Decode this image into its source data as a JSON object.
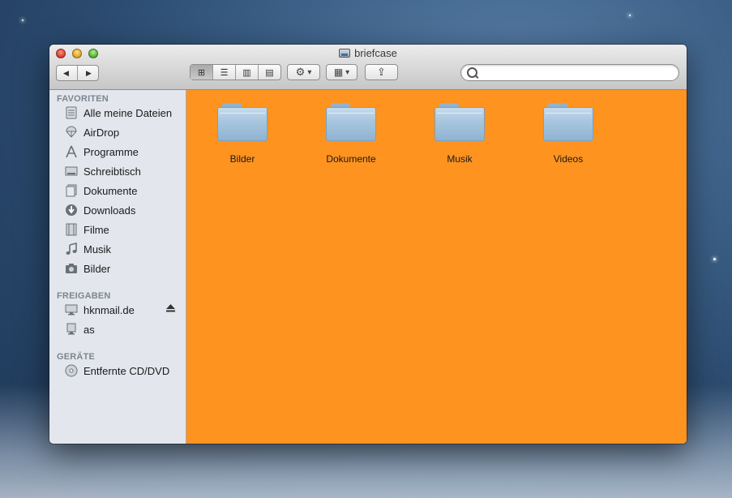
{
  "window": {
    "title": "briefcase"
  },
  "toolbar": {
    "back_icon": "◀",
    "forward_icon": "▶",
    "view_icons": [
      "⊞",
      "☰",
      "▥",
      "▤"
    ],
    "action_icon": "⚙",
    "arrange_icon": "▦",
    "share_icon": "⇪",
    "dropdown_icon": "▾"
  },
  "search": {
    "value": "",
    "placeholder": ""
  },
  "sidebar": {
    "favorites_header": "FAVORITEN",
    "favorites": [
      {
        "label": "Alle meine Dateien",
        "icon": "all-files-icon"
      },
      {
        "label": "AirDrop",
        "icon": "airdrop-icon"
      },
      {
        "label": "Programme",
        "icon": "applications-icon"
      },
      {
        "label": "Schreibtisch",
        "icon": "desktop-icon"
      },
      {
        "label": "Dokumente",
        "icon": "documents-icon"
      },
      {
        "label": "Downloads",
        "icon": "downloads-icon"
      },
      {
        "label": "Filme",
        "icon": "movies-icon"
      },
      {
        "label": "Musik",
        "icon": "music-icon"
      },
      {
        "label": "Bilder",
        "icon": "camera-icon"
      }
    ],
    "shared_header": "FREIGABEN",
    "shared": [
      {
        "label": "hknmail.de",
        "icon": "display-icon"
      },
      {
        "label": "as",
        "icon": "display-icon"
      }
    ],
    "devices_header": "GERÄTE",
    "devices": [
      {
        "label": "Entfernte CD/DVD",
        "icon": "disc-icon"
      }
    ]
  },
  "content": {
    "background_color": "#ff931f",
    "folders": [
      "Bilder",
      "Dokumente",
      "Musik",
      "Videos"
    ]
  }
}
